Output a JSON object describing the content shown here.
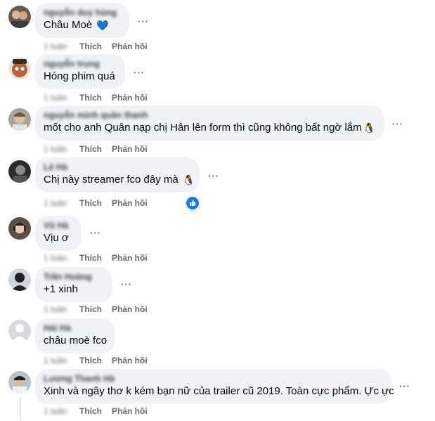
{
  "actions": {
    "like": "Thích",
    "reply": "Phản hồi"
  },
  "comments": [
    {
      "author": "nguyễn duy hùng",
      "text": "Châu Moè",
      "emoji": "💙",
      "time": "1 tuần"
    },
    {
      "author": "nguyễn trung",
      "text": "Hóng phim quá",
      "emoji": "",
      "time": "1 tuần"
    },
    {
      "author": "nguyễn minh quân thanh",
      "text": "mốt cho anh Quân nạp chị Hân lên form thì cũng không bất ngờ lắm",
      "emoji": "🐧",
      "time": "1 tuần"
    },
    {
      "author": "Lê Hà",
      "text": "Chị này streamer fco đây mà",
      "emoji": "🐧",
      "time": "1 tuần",
      "reaction": "like-reaction"
    },
    {
      "author": "Vũ Hà",
      "text": "Vịu ơ",
      "emoji": "",
      "time": "1 tuần"
    },
    {
      "author": "Trần Hoàng",
      "text": "+1 xinh",
      "emoji": "",
      "time": "1 tuần"
    },
    {
      "author": "Hải Hà",
      "text": "châu moè fco",
      "emoji": "",
      "time": "1 tuần"
    },
    {
      "author": "Lương Thanh Hà",
      "text": "Xinh và ngây thơ k kém bạn nữ của trailer cũ 2019. Toàn cực phẩm. Ực ực",
      "emoji": "",
      "time": "1 tuần"
    }
  ]
}
